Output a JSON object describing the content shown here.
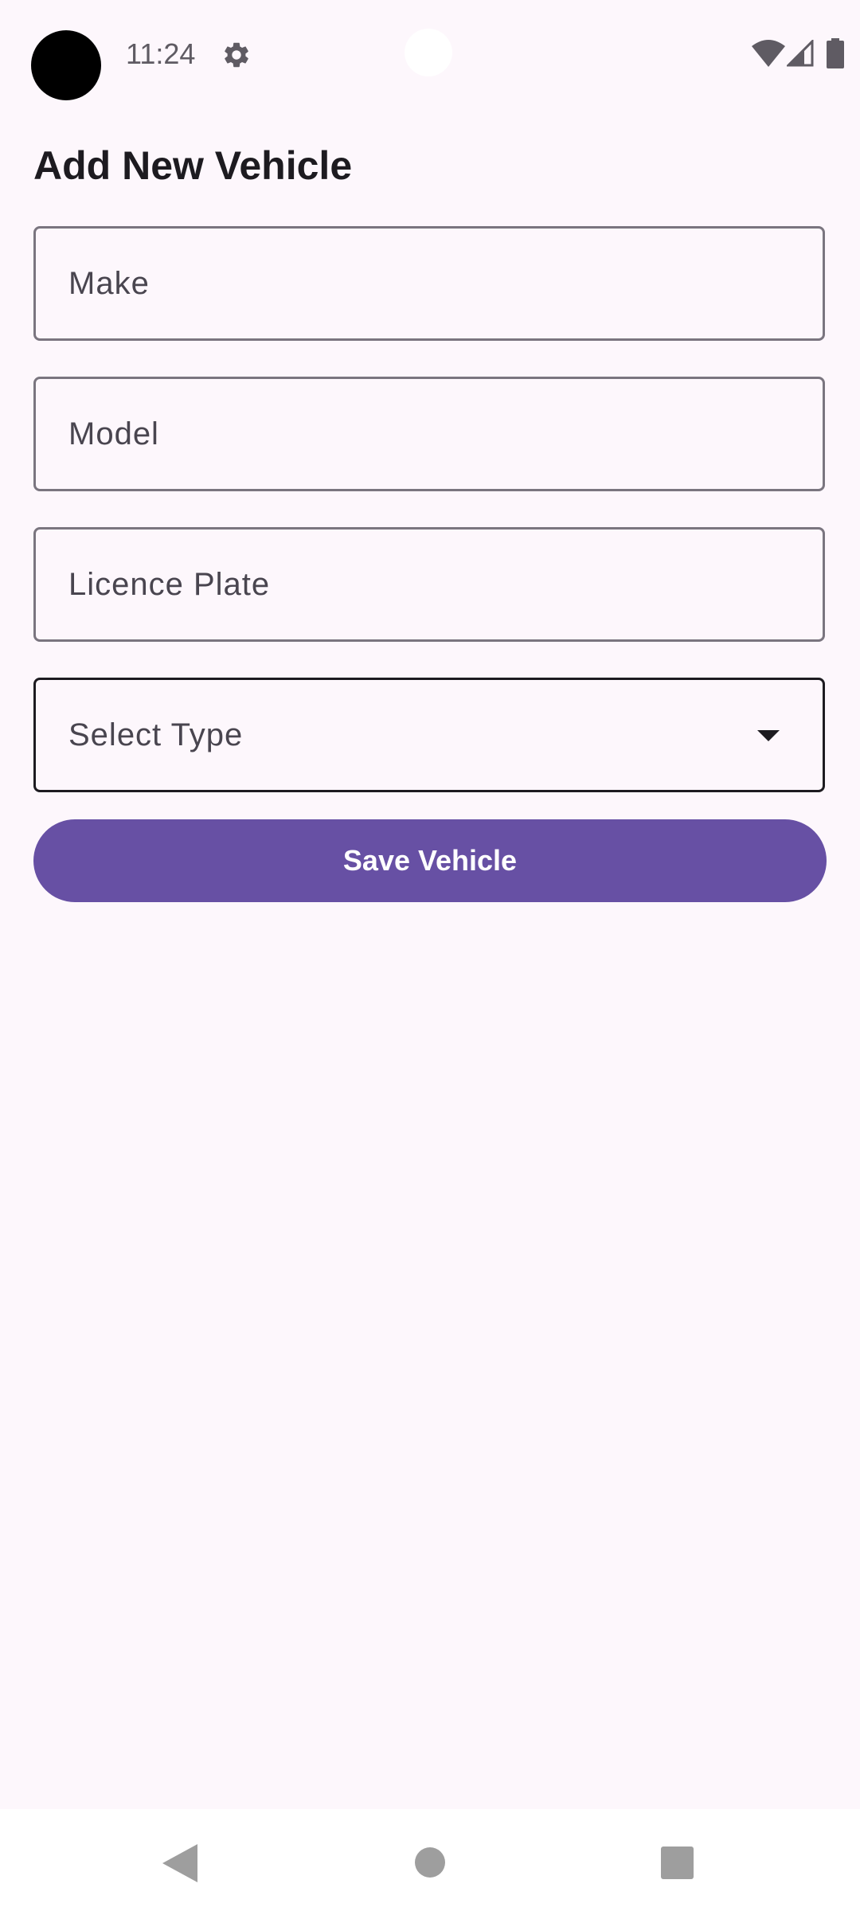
{
  "status_bar": {
    "time": "11:24",
    "icons": [
      "settings-icon",
      "wifi-icon",
      "signal-icon",
      "battery-icon"
    ]
  },
  "screen": {
    "title": "Add New Vehicle"
  },
  "form": {
    "make_placeholder": "Make",
    "model_placeholder": "Model",
    "plate_placeholder": "Licence Plate",
    "type_select_value": "Select Type",
    "save_label": "Save Vehicle"
  },
  "nav_bar": {
    "icons": [
      "back-icon",
      "home-icon",
      "recents-icon"
    ]
  },
  "colors": {
    "background": "#fdf7fc",
    "primary": "#6750a4",
    "outline": "#7a757f",
    "on_surface": "#1d1b20"
  }
}
